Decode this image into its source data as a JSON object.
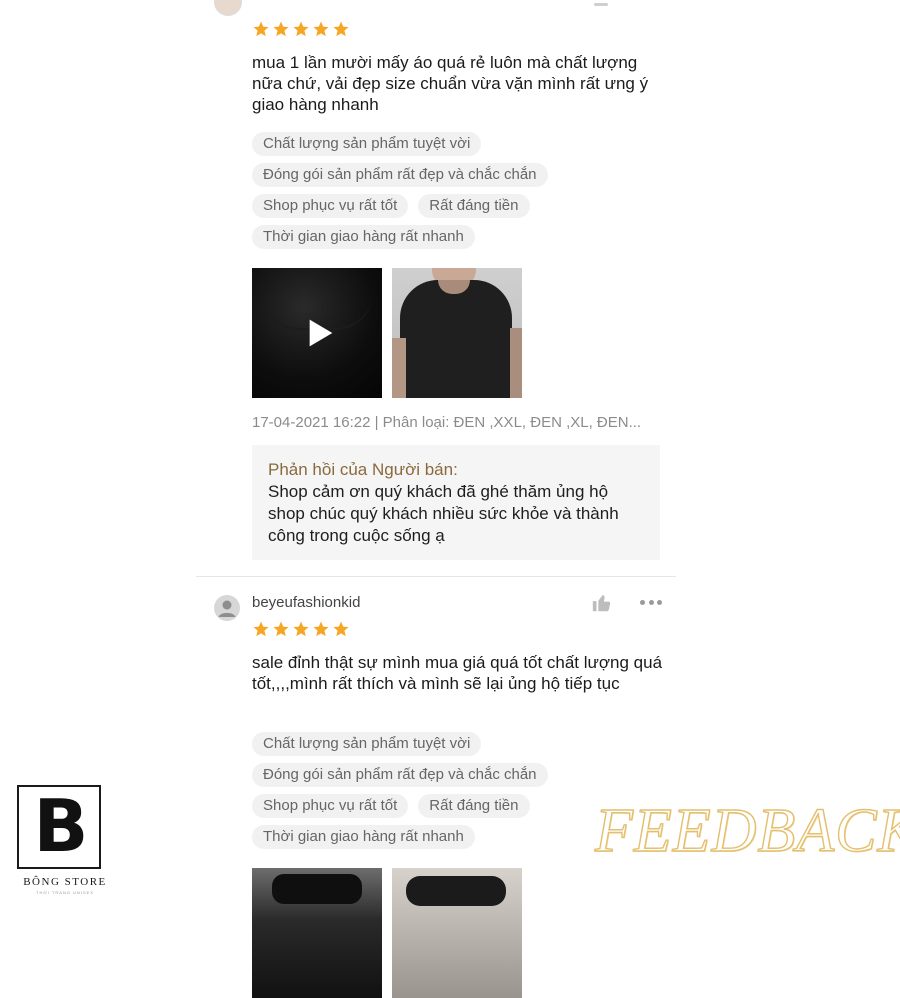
{
  "reviews": [
    {
      "text": "mua 1 lần mười mấy áo quá rẻ luôn mà chất lượng nữa chứ, vải đẹp size chuẩn vừa vặn mình rất ưng ý giao hàng nhanh",
      "rating": 5,
      "tags": [
        [
          "Chất lượng sản phẩm tuyệt vời"
        ],
        [
          "Đóng gói sản phẩm rất đẹp và chắc chắn"
        ],
        [
          "Shop phục vụ rất tốt",
          "Rất đáng tiền"
        ],
        [
          "Thời gian giao hàng rất nhanh"
        ]
      ],
      "meta": "17-04-2021 16:22 | Phân loại: ĐEN ,XXL, ĐEN ,XL, ĐEN...",
      "reply_title": "Phản hồi của Người bán:",
      "reply_text": "Shop cảm ơn quý khách đã ghé thăm ủng hộ shop chúc quý khách nhiều sức khỏe và thành công trong cuộc sống ạ"
    },
    {
      "username": "beyeufashionkid",
      "text": "sale đỉnh thật sự mình mua giá quá tốt chất lượng quá tốt,,,,mình rất thích và mình sẽ lại ủng hộ tiếp tục",
      "rating": 5,
      "tags": [
        [
          "Chất lượng sản phẩm tuyệt vời"
        ],
        [
          "Đóng gói sản phẩm rất đẹp và chắc chắn"
        ],
        [
          "Shop phục vụ rất tốt",
          "Rất đáng tiền"
        ],
        [
          "Thời gian giao hàng rất nhanh"
        ]
      ]
    }
  ],
  "logo": {
    "letter": "B",
    "name": "BÔNG STORE",
    "tagline": "THỜI TRANG UNISEX"
  },
  "watermark": "FEEDBACK",
  "colors": {
    "star": "#f6a623",
    "reply_title": "#8a6a3c",
    "watermark": "#e9c77a"
  },
  "icons": {
    "play": "play-icon",
    "like": "thumbs-up-icon",
    "more": "more-options-icon",
    "avatar": "user-avatar-icon"
  }
}
